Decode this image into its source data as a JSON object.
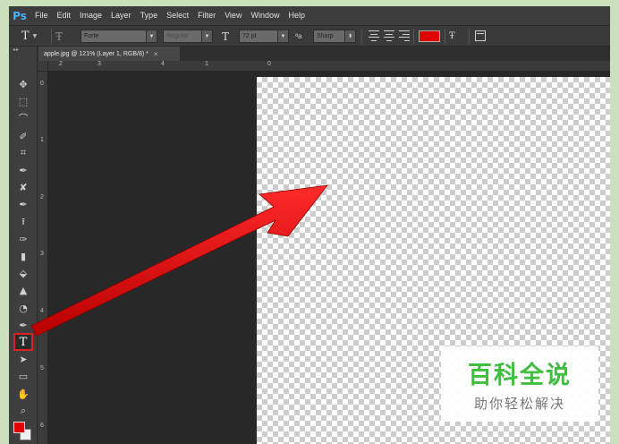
{
  "app": {
    "logo": "Ps"
  },
  "menu": [
    "File",
    "Edit",
    "Image",
    "Layer",
    "Type",
    "Select",
    "Filter",
    "View",
    "Window",
    "Help"
  ],
  "options": {
    "tool_preset_glyph": "T",
    "orientation_glyph": "Ŧ",
    "font_family": "Forte",
    "font_style": "Regular",
    "size_glyph": "T",
    "font_size": "72 pt",
    "aa_glyph": "ªa",
    "anti_alias": "Sharp",
    "text_color": "#e00000",
    "warp_glyph": "Ŧ"
  },
  "document": {
    "tab_label": "apple.jpg @ 121% (Layer 1, RGB/8) *",
    "close_glyph": "×"
  },
  "rulers": {
    "h_labels": [
      "2",
      "3",
      "4",
      "1",
      "0"
    ],
    "v_labels": [
      "0",
      "1",
      "2",
      "3",
      "4",
      "5",
      "6"
    ]
  },
  "tools": [
    {
      "name": "move-tool-icon",
      "glyph": "✥"
    },
    {
      "name": "marquee-tool-icon",
      "glyph": "⬚"
    },
    {
      "name": "lasso-tool-icon",
      "glyph": "⌒"
    },
    {
      "name": "quick-selection-tool-icon",
      "glyph": "✐"
    },
    {
      "name": "crop-tool-icon",
      "glyph": "⌗"
    },
    {
      "name": "eyedropper-tool-icon",
      "glyph": "✒"
    },
    {
      "name": "healing-brush-tool-icon",
      "glyph": "✘"
    },
    {
      "name": "brush-tool-icon",
      "glyph": "✒"
    },
    {
      "name": "clone-stamp-tool-icon",
      "glyph": "⭱"
    },
    {
      "name": "history-brush-tool-icon",
      "glyph": "✑"
    },
    {
      "name": "eraser-tool-icon",
      "glyph": "▮"
    },
    {
      "name": "paint-bucket-tool-icon",
      "glyph": "⬙"
    },
    {
      "name": "blur-tool-icon",
      "glyph": "▲"
    },
    {
      "name": "dodge-tool-icon",
      "glyph": "◔"
    },
    {
      "name": "pen-tool-icon",
      "glyph": "✒"
    },
    {
      "name": "type-tool-icon",
      "glyph": "T",
      "active": true
    },
    {
      "name": "path-selection-tool-icon",
      "glyph": "➤"
    },
    {
      "name": "rectangle-tool-icon",
      "glyph": "▭"
    },
    {
      "name": "hand-tool-icon",
      "glyph": "✋"
    },
    {
      "name": "zoom-tool-icon",
      "glyph": "⌕"
    }
  ],
  "colors": {
    "foreground": "#e00000",
    "background": "#f0f0f0",
    "annotation_arrow": "#e00000"
  },
  "watermark": {
    "main": "百科全说",
    "sub": "助你轻松解决"
  }
}
